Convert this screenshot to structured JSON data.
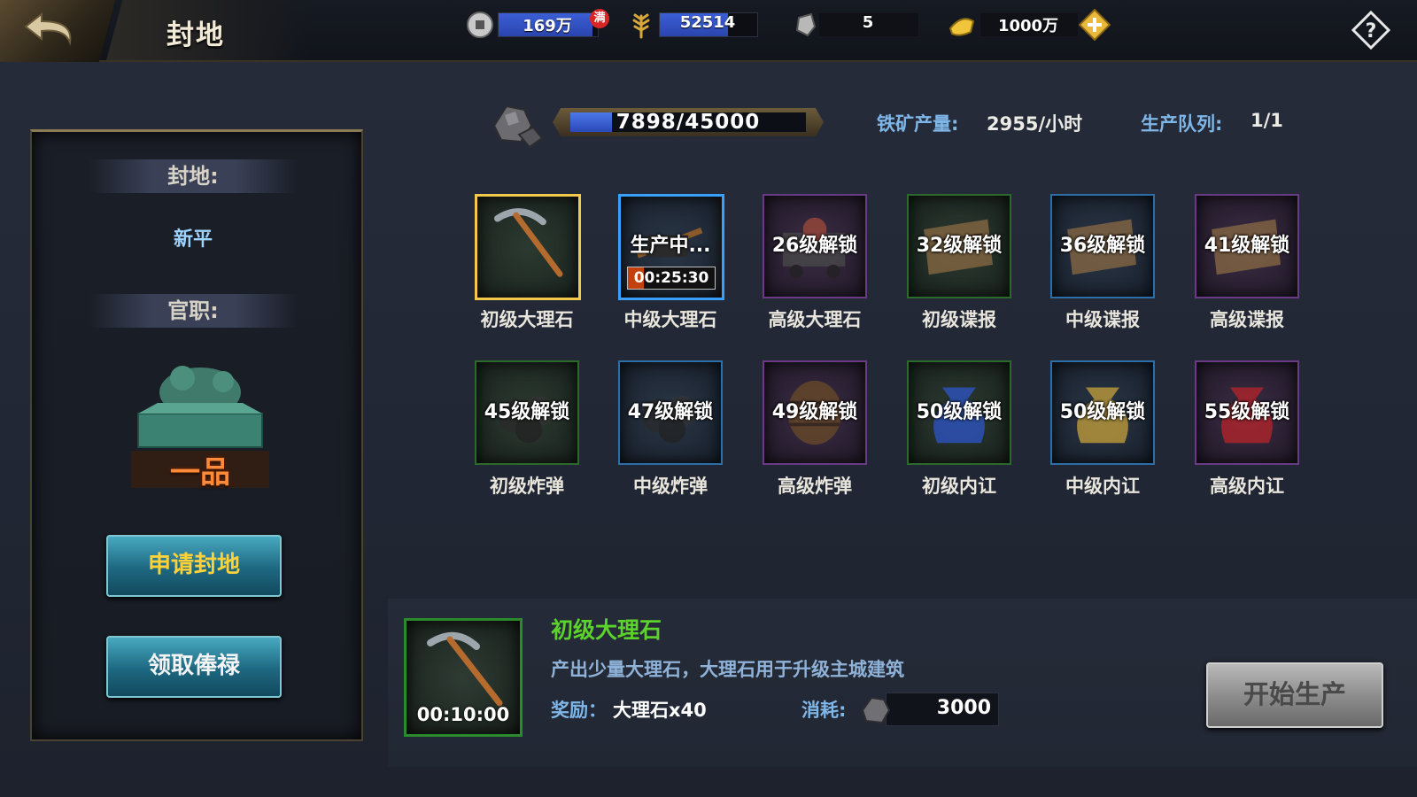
{
  "header": {
    "title": "封地",
    "resources": [
      {
        "icon": "silver-coin-icon",
        "value": "169万",
        "badge": "满",
        "fill": 0.95
      },
      {
        "icon": "grain-icon",
        "value": "52514",
        "fill": 0.7
      },
      {
        "icon": "marble-icon",
        "value": "5"
      },
      {
        "icon": "gold-ingot-icon",
        "value": "1000万"
      }
    ]
  },
  "left_panel": {
    "fief_label": "封地:",
    "fief_value": "新平",
    "rank_label": "官职:",
    "rank_value": "一品",
    "apply_button": "申请封地",
    "salary_button": "领取俸禄"
  },
  "mine": {
    "progress_text": "7898/45000",
    "progress": 0.1755,
    "output_label": "铁矿产量:",
    "output_value": "2955/小时",
    "queue_label": "生产队列:",
    "queue_value": "1/1"
  },
  "items": [
    {
      "name": "初级大理石",
      "overlay": "",
      "grade": "gold",
      "icon": "pickaxe-icon"
    },
    {
      "name": "中级大理石",
      "overlay": "生产中...",
      "timer": "00:25:30",
      "timer_progress": 0.18,
      "grade": "blue-bright",
      "icon": "tools-icon"
    },
    {
      "name": "高级大理石",
      "overlay": "26级解锁",
      "grade": "purple",
      "icon": "ore-cart-icon"
    },
    {
      "name": "初级谍报",
      "overlay": "32级解锁",
      "grade": "green",
      "icon": "scroll-map-icon"
    },
    {
      "name": "中级谍报",
      "overlay": "36级解锁",
      "grade": "blue",
      "icon": "scroll-map-icon"
    },
    {
      "name": "高级谍报",
      "overlay": "41级解锁",
      "grade": "purple",
      "icon": "scroll-map-icon"
    },
    {
      "name": "初级炸弹",
      "overlay": "45级解锁",
      "grade": "green",
      "icon": "bomb-icon"
    },
    {
      "name": "中级炸弹",
      "overlay": "47级解锁",
      "grade": "blue",
      "icon": "bomb-icon"
    },
    {
      "name": "高级炸弹",
      "overlay": "49级解锁",
      "grade": "purple",
      "icon": "barrel-icon"
    },
    {
      "name": "初级内讧",
      "overlay": "50级解锁",
      "grade": "green",
      "icon": "pouch-icon"
    },
    {
      "name": "中级内讧",
      "overlay": "50级解锁",
      "grade": "blue",
      "icon": "pouch-icon"
    },
    {
      "name": "高级内讧",
      "overlay": "55级解锁",
      "grade": "purple",
      "icon": "pouch-icon"
    }
  ],
  "detail": {
    "title": "初级大理石",
    "timer": "00:10:00",
    "description": "产出少量大理石，大理石用于升级主城建筑",
    "reward_label": "奖励：",
    "reward_value": "大理石x40",
    "cost_label": "消耗:",
    "cost_value": "3000",
    "start_button": "开始生产"
  },
  "colors": {
    "accent_blue": "#3b5fd6",
    "green_title": "#5cd22d",
    "label_blue": "#7fb6e8",
    "gold_border": "#f2c94a"
  }
}
